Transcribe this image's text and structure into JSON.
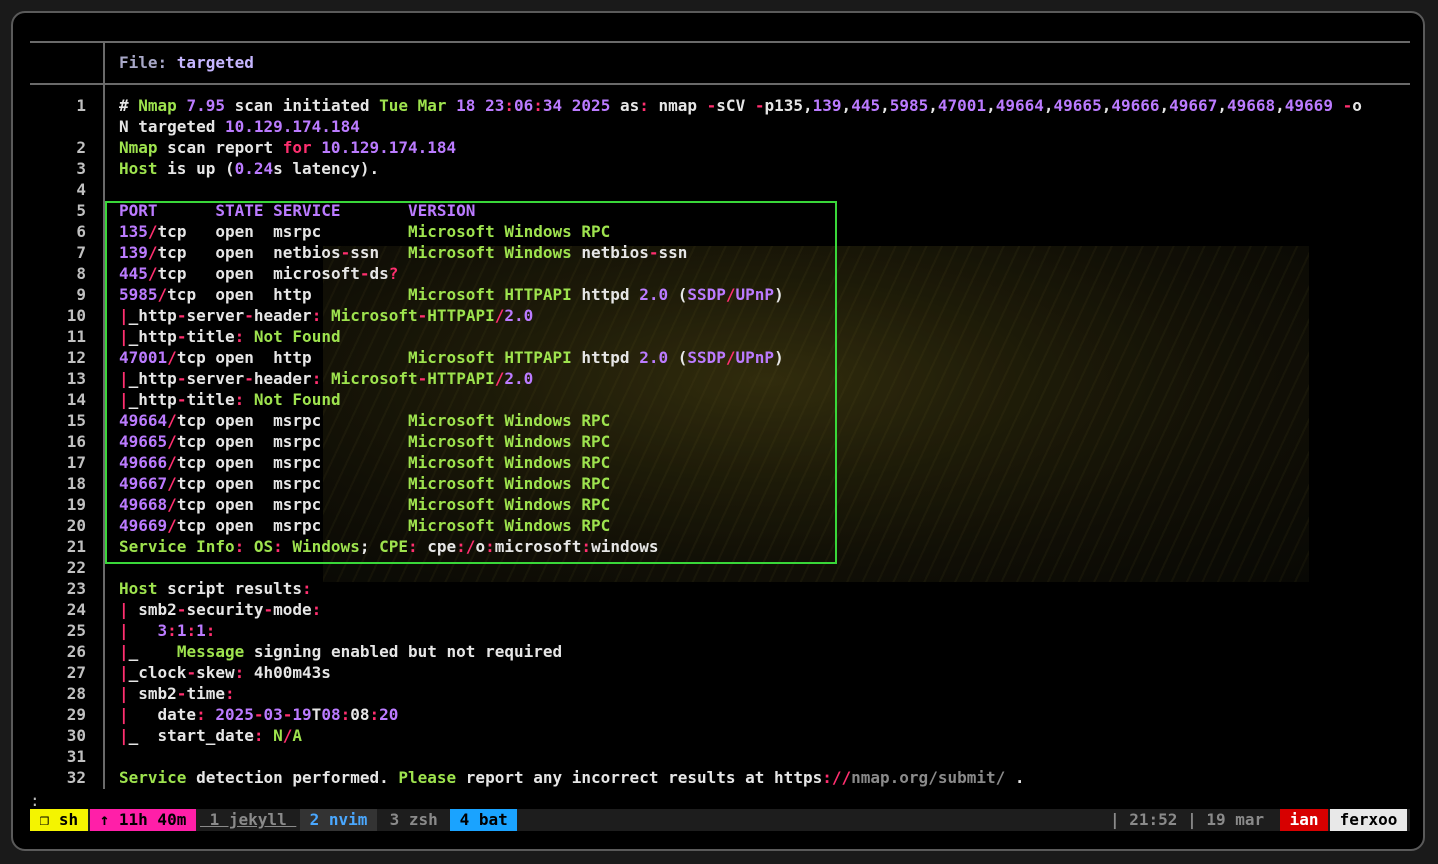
{
  "file_header": {
    "label": "File: ",
    "name": "targeted"
  },
  "line_numbers": [
    "1",
    "",
    "2",
    "3",
    "4",
    "5",
    "6",
    "7",
    "8",
    "9",
    "10",
    "11",
    "12",
    "13",
    "14",
    "15",
    "16",
    "17",
    "18",
    "19",
    "20",
    "21",
    "22",
    "23",
    "24",
    "25",
    "26",
    "27",
    "28",
    "29",
    "30",
    "31",
    "32"
  ],
  "lines": [
    [
      [
        "w",
        "# "
      ],
      [
        "g",
        "Nmap "
      ],
      [
        "p",
        "7.95 "
      ],
      [
        "w",
        "scan initiated "
      ],
      [
        "g",
        "Tue Mar "
      ],
      [
        "p",
        "18 23"
      ],
      [
        "m",
        ":"
      ],
      [
        "p",
        "06"
      ],
      [
        "m",
        ":"
      ],
      [
        "p",
        "34 2025 "
      ],
      [
        "w",
        "as"
      ],
      [
        "m",
        ": "
      ],
      [
        "w",
        "nmap "
      ],
      [
        "m",
        "-"
      ],
      [
        "w",
        "sCV "
      ],
      [
        "m",
        "-"
      ],
      [
        "w",
        "p135,"
      ],
      [
        "p",
        "139"
      ],
      [
        "w",
        ","
      ],
      [
        "p",
        "445"
      ],
      [
        "w",
        ","
      ],
      [
        "p",
        "5985"
      ],
      [
        "w",
        ","
      ],
      [
        "p",
        "47001"
      ],
      [
        "w",
        ","
      ],
      [
        "p",
        "49664"
      ],
      [
        "w",
        ","
      ],
      [
        "p",
        "49665"
      ],
      [
        "w",
        ","
      ],
      [
        "p",
        "49666"
      ],
      [
        "w",
        ","
      ],
      [
        "p",
        "49667"
      ],
      [
        "w",
        ","
      ],
      [
        "p",
        "49668"
      ],
      [
        "w",
        ","
      ],
      [
        "p",
        "49669 "
      ],
      [
        "m",
        "-"
      ],
      [
        "w",
        "o"
      ]
    ],
    [
      [
        "w",
        "N targeted "
      ],
      [
        "p",
        "10.129.174.184"
      ]
    ],
    [
      [
        "g",
        "Nmap "
      ],
      [
        "w",
        "scan report "
      ],
      [
        "m",
        "for "
      ],
      [
        "p",
        "10.129.174.184"
      ]
    ],
    [
      [
        "g",
        "Host "
      ],
      [
        "w",
        "is up ("
      ],
      [
        "p",
        "0.24"
      ],
      [
        "w",
        "s latency)."
      ]
    ],
    [
      [
        "w",
        ""
      ]
    ],
    [
      [
        "p",
        "PORT      STATE SERVICE       VERSION"
      ]
    ],
    [
      [
        "p",
        "135"
      ],
      [
        "m",
        "/"
      ],
      [
        "w",
        "tcp   open  msrpc         "
      ],
      [
        "g",
        "Microsoft Windows RPC"
      ]
    ],
    [
      [
        "p",
        "139"
      ],
      [
        "m",
        "/"
      ],
      [
        "w",
        "tcp   open  netbios"
      ],
      [
        "m",
        "-"
      ],
      [
        "w",
        "ssn   "
      ],
      [
        "g",
        "Microsoft Windows "
      ],
      [
        "w",
        "netbios"
      ],
      [
        "m",
        "-"
      ],
      [
        "w",
        "ssn"
      ]
    ],
    [
      [
        "p",
        "445"
      ],
      [
        "m",
        "/"
      ],
      [
        "w",
        "tcp   open  microsoft"
      ],
      [
        "m",
        "-"
      ],
      [
        "w",
        "ds"
      ],
      [
        "m",
        "?"
      ]
    ],
    [
      [
        "p",
        "5985"
      ],
      [
        "m",
        "/"
      ],
      [
        "w",
        "tcp  open  http          "
      ],
      [
        "g",
        "Microsoft HTTPAPI "
      ],
      [
        "w",
        "httpd "
      ],
      [
        "p",
        "2.0 "
      ],
      [
        "w",
        "("
      ],
      [
        "p",
        "SSDP"
      ],
      [
        "m",
        "/"
      ],
      [
        "p",
        "UPnP"
      ],
      [
        "w",
        ")"
      ]
    ],
    [
      [
        "m",
        "|"
      ],
      [
        "w",
        "_http"
      ],
      [
        "m",
        "-"
      ],
      [
        "w",
        "server"
      ],
      [
        "m",
        "-"
      ],
      [
        "w",
        "header"
      ],
      [
        "m",
        ": "
      ],
      [
        "g",
        "Microsoft"
      ],
      [
        "m",
        "-"
      ],
      [
        "g",
        "HTTPAPI"
      ],
      [
        "m",
        "/"
      ],
      [
        "p",
        "2.0"
      ]
    ],
    [
      [
        "m",
        "|"
      ],
      [
        "w",
        "_http"
      ],
      [
        "m",
        "-"
      ],
      [
        "w",
        "title"
      ],
      [
        "m",
        ": "
      ],
      [
        "g",
        "Not Found"
      ]
    ],
    [
      [
        "p",
        "47001"
      ],
      [
        "m",
        "/"
      ],
      [
        "w",
        "tcp open  http          "
      ],
      [
        "g",
        "Microsoft HTTPAPI "
      ],
      [
        "w",
        "httpd "
      ],
      [
        "p",
        "2.0 "
      ],
      [
        "w",
        "("
      ],
      [
        "p",
        "SSDP"
      ],
      [
        "m",
        "/"
      ],
      [
        "p",
        "UPnP"
      ],
      [
        "w",
        ")"
      ]
    ],
    [
      [
        "m",
        "|"
      ],
      [
        "w",
        "_http"
      ],
      [
        "m",
        "-"
      ],
      [
        "w",
        "server"
      ],
      [
        "m",
        "-"
      ],
      [
        "w",
        "header"
      ],
      [
        "m",
        ": "
      ],
      [
        "g",
        "Microsoft"
      ],
      [
        "m",
        "-"
      ],
      [
        "g",
        "HTTPAPI"
      ],
      [
        "m",
        "/"
      ],
      [
        "p",
        "2.0"
      ]
    ],
    [
      [
        "m",
        "|"
      ],
      [
        "w",
        "_http"
      ],
      [
        "m",
        "-"
      ],
      [
        "w",
        "title"
      ],
      [
        "m",
        ": "
      ],
      [
        "g",
        "Not Found"
      ]
    ],
    [
      [
        "p",
        "49664"
      ],
      [
        "m",
        "/"
      ],
      [
        "w",
        "tcp open  msrpc         "
      ],
      [
        "g",
        "Microsoft Windows RPC"
      ]
    ],
    [
      [
        "p",
        "49665"
      ],
      [
        "m",
        "/"
      ],
      [
        "w",
        "tcp open  msrpc         "
      ],
      [
        "g",
        "Microsoft Windows RPC"
      ]
    ],
    [
      [
        "p",
        "49666"
      ],
      [
        "m",
        "/"
      ],
      [
        "w",
        "tcp open  msrpc         "
      ],
      [
        "g",
        "Microsoft Windows RPC"
      ]
    ],
    [
      [
        "p",
        "49667"
      ],
      [
        "m",
        "/"
      ],
      [
        "w",
        "tcp open  msrpc         "
      ],
      [
        "g",
        "Microsoft Windows RPC"
      ]
    ],
    [
      [
        "p",
        "49668"
      ],
      [
        "m",
        "/"
      ],
      [
        "w",
        "tcp open  msrpc         "
      ],
      [
        "g",
        "Microsoft Windows RPC"
      ]
    ],
    [
      [
        "p",
        "49669"
      ],
      [
        "m",
        "/"
      ],
      [
        "w",
        "tcp open  msrpc         "
      ],
      [
        "g",
        "Microsoft Windows RPC"
      ]
    ],
    [
      [
        "g",
        "Service Info"
      ],
      [
        "m",
        ": "
      ],
      [
        "g",
        "OS"
      ],
      [
        "m",
        ": "
      ],
      [
        "g",
        "Windows"
      ],
      [
        "w",
        "; "
      ],
      [
        "g",
        "CPE"
      ],
      [
        "m",
        ": "
      ],
      [
        "w",
        "cpe"
      ],
      [
        "m",
        ":/"
      ],
      [
        "w",
        "o"
      ],
      [
        "m",
        ":"
      ],
      [
        "w",
        "microsoft"
      ],
      [
        "m",
        ":"
      ],
      [
        "w",
        "windows"
      ]
    ],
    [
      [
        "w",
        ""
      ]
    ],
    [
      [
        "g",
        "Host "
      ],
      [
        "w",
        "script results"
      ],
      [
        "m",
        ":"
      ]
    ],
    [
      [
        "m",
        "| "
      ],
      [
        "w",
        "smb2"
      ],
      [
        "m",
        "-"
      ],
      [
        "w",
        "security"
      ],
      [
        "m",
        "-"
      ],
      [
        "w",
        "mode"
      ],
      [
        "m",
        ":"
      ]
    ],
    [
      [
        "m",
        "|   "
      ],
      [
        "p",
        "3"
      ],
      [
        "m",
        ":"
      ],
      [
        "p",
        "1"
      ],
      [
        "m",
        ":"
      ],
      [
        "p",
        "1"
      ],
      [
        "m",
        ":"
      ]
    ],
    [
      [
        "m",
        "|"
      ],
      [
        "w",
        "_    "
      ],
      [
        "g",
        "Message "
      ],
      [
        "w",
        "signing enabled but not required"
      ]
    ],
    [
      [
        "m",
        "|"
      ],
      [
        "w",
        "_clock"
      ],
      [
        "m",
        "-"
      ],
      [
        "w",
        "skew"
      ],
      [
        "m",
        ": "
      ],
      [
        "w",
        "4h00m43s"
      ]
    ],
    [
      [
        "m",
        "| "
      ],
      [
        "w",
        "smb2"
      ],
      [
        "m",
        "-"
      ],
      [
        "w",
        "time"
      ],
      [
        "m",
        ":"
      ]
    ],
    [
      [
        "m",
        "|   "
      ],
      [
        "w",
        "date"
      ],
      [
        "m",
        ": "
      ],
      [
        "p",
        "2025"
      ],
      [
        "m",
        "-"
      ],
      [
        "p",
        "03"
      ],
      [
        "m",
        "-"
      ],
      [
        "p",
        "19"
      ],
      [
        "w",
        "T"
      ],
      [
        "p",
        "08"
      ],
      [
        "m",
        ":"
      ],
      [
        "w",
        "08"
      ],
      [
        "m",
        ":"
      ],
      [
        "p",
        "20"
      ]
    ],
    [
      [
        "m",
        "|"
      ],
      [
        "w",
        "_  start_date"
      ],
      [
        "m",
        ": "
      ],
      [
        "g",
        "N"
      ],
      [
        "m",
        "/"
      ],
      [
        "g",
        "A"
      ]
    ],
    [
      [
        "w",
        ""
      ]
    ],
    [
      [
        "g",
        "Service "
      ],
      [
        "w",
        "detection performed. "
      ],
      [
        "g",
        "Please "
      ],
      [
        "w",
        "report any incorrect results at https"
      ],
      [
        "m",
        "://"
      ],
      [
        "gr",
        "nmap.org/submit/ "
      ],
      [
        "w",
        "."
      ]
    ]
  ],
  "cmdline": ":",
  "statusbar": {
    "left": [
      {
        "text": " ❐ sh ",
        "bg": "#f4f400",
        "fg": "#000000"
      },
      {
        "text": " ↑ 11h 40m ",
        "bg": "#ff1fa8",
        "fg": "#000000"
      },
      {
        "text": " 1 jekyll ",
        "bg": "#1d1d1d",
        "fg": "#8a8a8a",
        "underline": true
      },
      {
        "text": " 2 nvim ",
        "bg": "#333333",
        "fg": "#4aa8ff"
      },
      {
        "text": " 3 zsh ",
        "bg": "#1d1d1d",
        "fg": "#8a8a8a"
      },
      {
        "text": " 4 bat ",
        "bg": "#1aa3ff",
        "fg": "#000000"
      }
    ],
    "right": [
      {
        "text": "| 21:52 | 19 mar ",
        "bg": "#1d1d1d",
        "fg": "#8a8a8a"
      },
      {
        "text": " ian ",
        "bg": "#d70000",
        "fg": "#ffffff"
      },
      {
        "text": " ferxoo ",
        "bg": "#e8e8e8",
        "fg": "#000000"
      }
    ]
  }
}
